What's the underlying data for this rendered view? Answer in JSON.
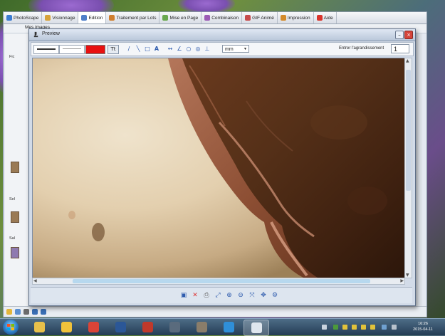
{
  "main_window": {
    "tabs": [
      {
        "label": "PhotoScape",
        "color": "#3b7bd1"
      },
      {
        "label": "Visionnage",
        "color": "#d8a23a"
      },
      {
        "label": "Edition",
        "color": "#4f7fc9"
      },
      {
        "label": "Traitement par Lots",
        "color": "#d07f2f"
      },
      {
        "label": "Mise en Page",
        "color": "#6aa84f"
      },
      {
        "label": "Combinaison",
        "color": "#9c5bb5"
      },
      {
        "label": "GIF Animé",
        "color": "#c74b4b"
      },
      {
        "label": "Impression",
        "color": "#d48a29"
      },
      {
        "label": "Aide",
        "color": "#d9342b"
      }
    ],
    "active_tab": "Edition",
    "menu_label": "Mes images",
    "side_labels": [
      "Fic",
      "Sel",
      "Sal"
    ]
  },
  "preview": {
    "title": "Preview",
    "toolbar": {
      "unit_select": "mm",
      "zoom_label": "Entrer l'agrandissement",
      "zoom_value": "1",
      "draw_color": "#e81010"
    },
    "scroll": {
      "horizontal_position": 0.55,
      "vertical_position": 0.05
    }
  },
  "taskbar": {
    "apps": [
      {
        "name": "explorer-app",
        "color": "#e8c04a"
      },
      {
        "name": "photoscape-app",
        "color": "#f0c23a"
      },
      {
        "name": "chrome-app",
        "color": "#db4437"
      },
      {
        "name": "word-app",
        "color": "#2b5797"
      },
      {
        "name": "disk-app",
        "color": "#c0392b"
      },
      {
        "name": "media-app",
        "color": "#5a6b7d"
      },
      {
        "name": "picture-app",
        "color": "#8a7d6a"
      },
      {
        "name": "ie-app",
        "color": "#2f8fd8"
      },
      {
        "name": "microscope-app",
        "color": "#dfe6ee"
      }
    ],
    "clock_time": "16:26",
    "clock_date": "2015-04-11"
  }
}
